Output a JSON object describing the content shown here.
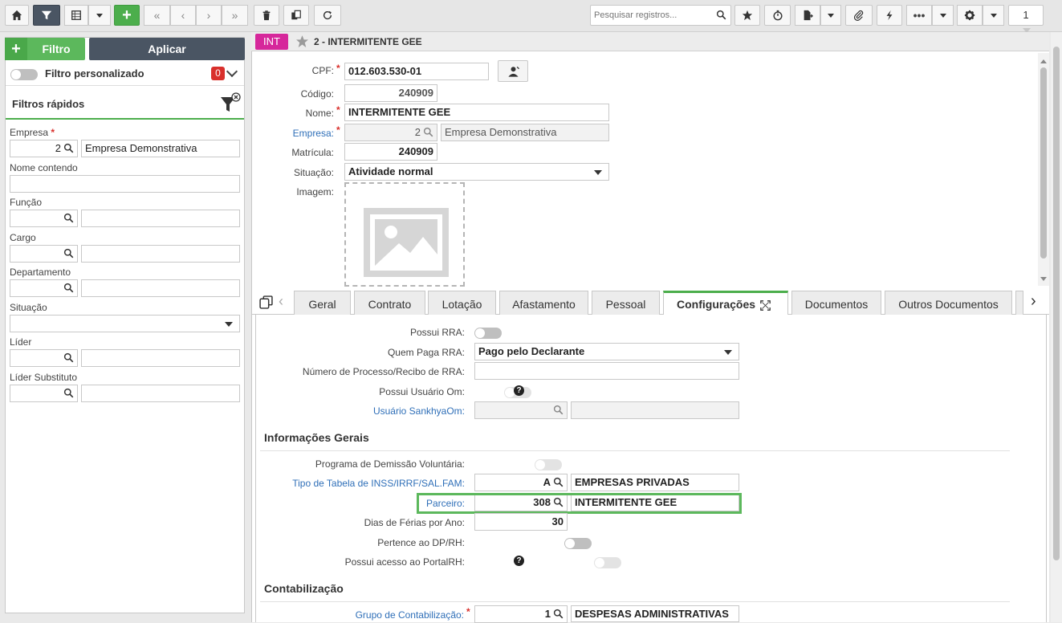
{
  "toolbar": {
    "search_placeholder": "Pesquisar registros...",
    "page_number": "1",
    "add_label": "+"
  },
  "left_panel": {
    "filtro_label": "Filtro",
    "aplicar_label": "Aplicar",
    "filtro_personalizado": "Filtro personalizado",
    "filter_count": "0",
    "filtros_rapidos": "Filtros rápidos",
    "fields": {
      "empresa_label": "Empresa",
      "empresa_code": "2",
      "empresa_name": "Empresa Demonstrativa",
      "nome_contendo_label": "Nome contendo",
      "funcao_label": "Função",
      "cargo_label": "Cargo",
      "departamento_label": "Departamento",
      "situacao_label": "Situação",
      "lider_label": "Líder",
      "lider_substituto_label": "Líder Substituto"
    }
  },
  "record": {
    "badge": "INT",
    "title": "2 - INTERMITENTE GEE",
    "cpf_label": "CPF:",
    "cpf_value": "012.603.530-01",
    "codigo_label": "Código:",
    "codigo_value": "240909",
    "nome_label": "Nome:",
    "nome_value": "INTERMITENTE GEE",
    "empresa_label": "Empresa:",
    "empresa_code": "2",
    "empresa_name": "Empresa Demonstrativa",
    "matricula_label": "Matrícula:",
    "matricula_value": "240909",
    "situacao_label": "Situação:",
    "situacao_value": "Atividade normal",
    "imagem_label": "Imagem:"
  },
  "tabs": [
    "Geral",
    "Contrato",
    "Lotação",
    "Afastamento",
    "Pessoal",
    "Configurações",
    "Documentos",
    "Outros Documentos"
  ],
  "config": {
    "possui_rra_label": "Possui RRA:",
    "quem_paga_rra_label": "Quem Paga RRA:",
    "quem_paga_rra_value": "Pago pelo Declarante",
    "numero_processo_label": "Número de Processo/Recibo de RRA:",
    "possui_usuario_om_label": "Possui Usuário Om:",
    "usuario_sankhyaom_label": "Usuário SankhyaOm:",
    "section_info_gerais": "Informações Gerais",
    "programa_demissao_label": "Programa de Demissão Voluntária:",
    "tipo_tabela_label": "Tipo de Tabela de INSS/IRRF/SAL.FAM:",
    "tipo_tabela_code": "A",
    "tipo_tabela_name": "EMPRESAS PRIVADAS",
    "parceiro_label": "Parceiro:",
    "parceiro_code": "308",
    "parceiro_name": "INTERMITENTE GEE",
    "dias_ferias_label": "Dias de Férias por Ano:",
    "dias_ferias_value": "30",
    "pertence_dprh_label": "Pertence ao DP/RH:",
    "possui_portalrh_label": "Possui acesso ao PortalRH:",
    "section_contabilizacao": "Contabilização",
    "grupo_contabilizacao_label": "Grupo de Contabilização:",
    "grupo_contabilizacao_code": "1",
    "grupo_contabilizacao_name": "DESPESAS ADMINISTRATIVAS",
    "help_symbol": "?"
  },
  "colors": {
    "accent_green": "#4cae4c",
    "dark_button": "#4a5563",
    "badge_magenta": "#d6279b",
    "link_blue": "#2f6fb8",
    "required_red": "#d9302c"
  }
}
